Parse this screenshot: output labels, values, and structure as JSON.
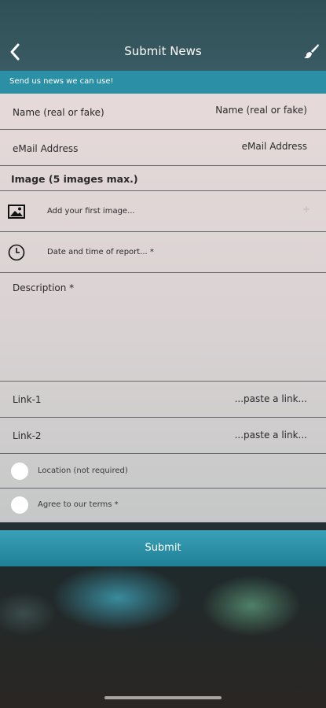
{
  "header": {
    "title": "Submit News"
  },
  "banner": {
    "text": "Send us news we can use!"
  },
  "form": {
    "name_label": "Name (real or fake)",
    "name_placeholder": "Name (real or fake)",
    "email_label": "eMail Address",
    "email_placeholder": "eMail Address",
    "image_section_label": "Image (5 images max.)",
    "add_image_label": "Add your first image...",
    "add_image_plus": "+",
    "datetime_label": "Date and time of report... *",
    "description_label": "Description *",
    "link1_label": "Link-1",
    "link1_placeholder": "...paste a link...",
    "link2_label": "Link-2",
    "link2_placeholder": "...paste a link...",
    "location_label": "Location (not required)",
    "terms_label": "Agree to our terms *"
  },
  "submit": {
    "label": "Submit"
  },
  "colors": {
    "accent": "#2b8fa6",
    "form_bg": "#ece0e0",
    "divider": "#666a6c"
  }
}
